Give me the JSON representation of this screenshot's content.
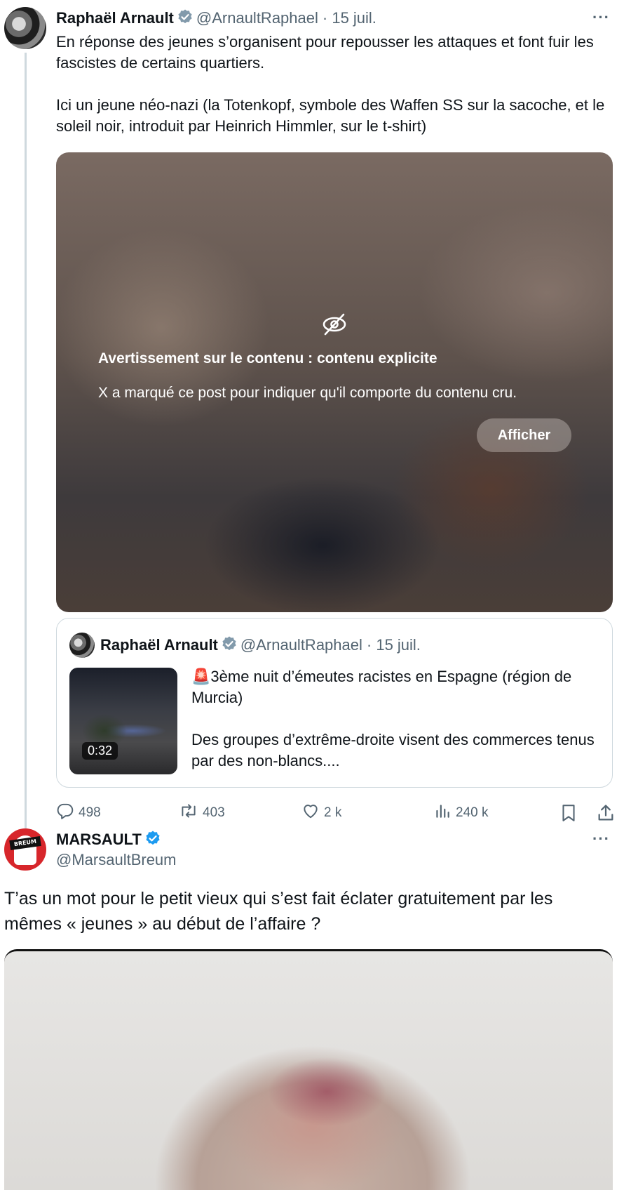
{
  "tweet1": {
    "author_name": "Raphaël Arnault",
    "handle": "@ArnaultRaphael",
    "date": "· 15 juil.",
    "more": "···",
    "text_p1": "En réponse des jeunes s’organisent pour repousser les attaques et font fuir les fascistes de certains quartiers.",
    "text_p2": "Ici un jeune néo-nazi (la Totenkopf, symbole des Waffen SS sur la sacoche, et le soleil noir, introduit par Heinrich Himmler, sur le t-shirt)",
    "warning_title": "Avertissement sur le contenu : contenu explicite",
    "warning_text": "X a marqué ce post pour indiquer qu'il comporte du contenu cru.",
    "show_button": "Afficher",
    "quote": {
      "author_name": "Raphaël Arnault",
      "handle": "@ArnaultRaphael",
      "date": "· 15 juil.",
      "video_duration": "0:32",
      "text_p1": "🚨3ème nuit d’émeutes racistes en Espagne (région de Murcia)",
      "text_p2": "Des groupes d’extrême-droite visent des commerces tenus par des non-blancs...."
    },
    "stats": {
      "replies": "498",
      "reposts": "403",
      "likes": "2 k",
      "views": "240 k"
    }
  },
  "tweet2": {
    "author_name": "MARSAULT",
    "handle": "@MarsaultBreum",
    "more": "···",
    "avatar_text": "BREUM",
    "text": "T’as un mot pour le petit vieux qui s’est fait éclater gratuitement par les mêmes « jeunes » au début de l’affaire ?"
  },
  "colors": {
    "verified": "#1d9bf0",
    "muted": "#536471",
    "border": "#cfd9de"
  }
}
